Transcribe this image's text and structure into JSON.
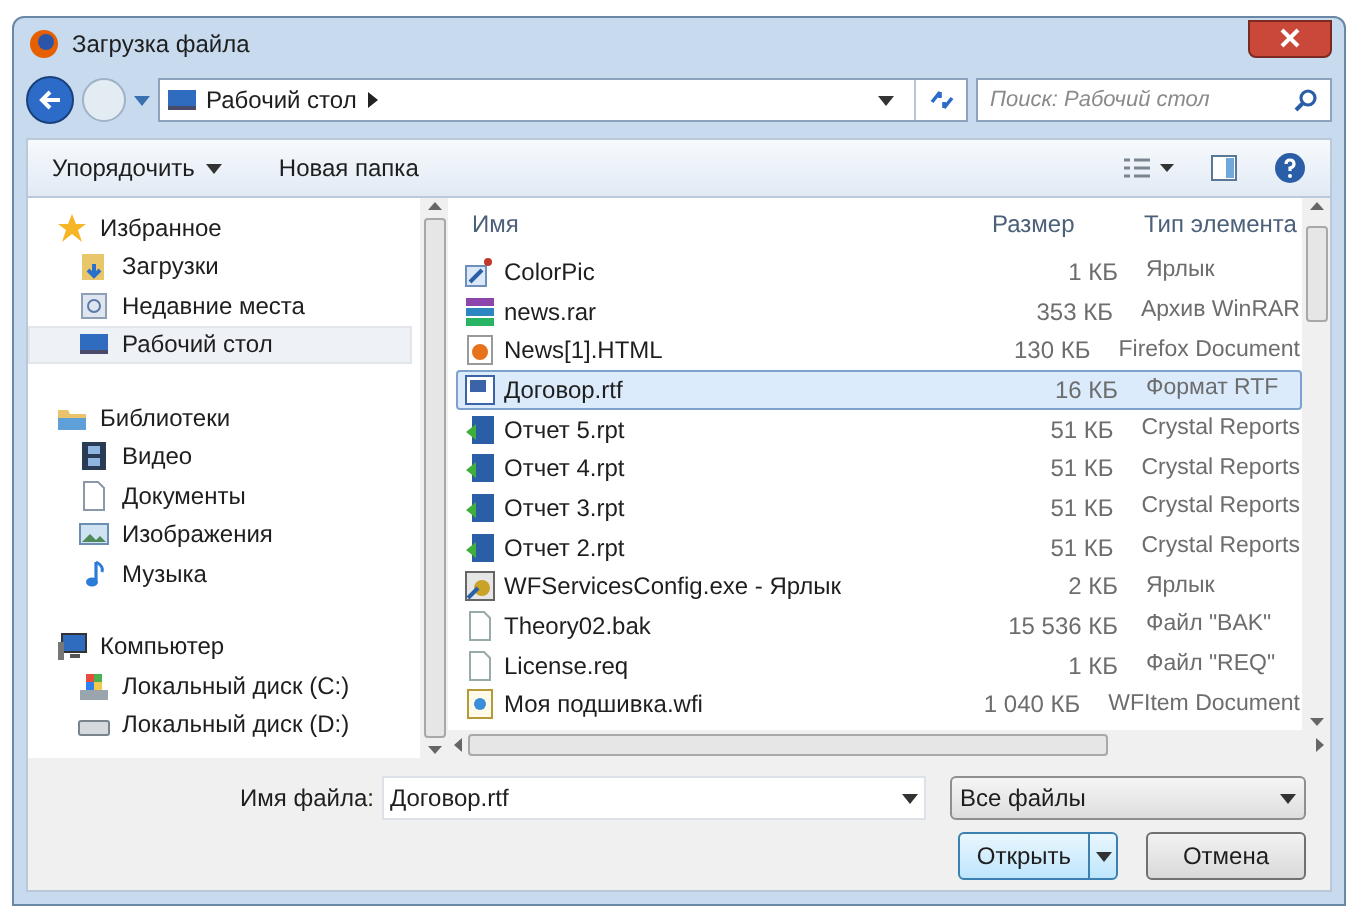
{
  "window": {
    "title": "Загрузка файла"
  },
  "address": {
    "location": "Рабочий стол"
  },
  "search": {
    "placeholder": "Поиск: Рабочий стол"
  },
  "toolbar": {
    "organize": "Упорядочить",
    "new_folder": "Новая папка"
  },
  "sidebar": {
    "groups": [
      {
        "label": "Избранное",
        "kind": "favorites",
        "children": [
          {
            "label": "Загрузки",
            "kind": "downloads",
            "selected": false
          },
          {
            "label": "Недавние места",
            "kind": "recent",
            "selected": false
          },
          {
            "label": "Рабочий стол",
            "kind": "desktop",
            "selected": true
          }
        ]
      },
      {
        "label": "Библиотеки",
        "kind": "libraries",
        "children": [
          {
            "label": "Видео",
            "kind": "video",
            "selected": false
          },
          {
            "label": "Документы",
            "kind": "documents",
            "selected": false
          },
          {
            "label": "Изображения",
            "kind": "images",
            "selected": false
          },
          {
            "label": "Музыка",
            "kind": "music",
            "selected": false
          }
        ]
      },
      {
        "label": "Компьютер",
        "kind": "computer",
        "children": [
          {
            "label": "Локальный диск (C:)",
            "kind": "system_drive",
            "selected": false
          },
          {
            "label": "Локальный диск (D:)",
            "kind": "drive",
            "selected": false
          }
        ]
      }
    ]
  },
  "table": {
    "columns": [
      "Имя",
      "Размер",
      "Тип элемента"
    ],
    "rows": [
      {
        "name": "ColorPic",
        "size": "1 КБ",
        "type": "Ярлык",
        "kind": "shortcut",
        "selected": false
      },
      {
        "name": "news.rar",
        "size": "353 КБ",
        "type": "Архив WinRAR",
        "kind": "archive",
        "selected": false
      },
      {
        "name": "News[1].HTML",
        "size": "130 КБ",
        "type": "Firefox Document",
        "kind": "html",
        "selected": false
      },
      {
        "name": "Договор.rtf",
        "size": "16 КБ",
        "type": "Формат RTF",
        "kind": "rtf",
        "selected": true
      },
      {
        "name": "Отчет 5.rpt",
        "size": "51 КБ",
        "type": "Crystal Reports",
        "kind": "report",
        "selected": false
      },
      {
        "name": "Отчет 4.rpt",
        "size": "51 КБ",
        "type": "Crystal Reports",
        "kind": "report",
        "selected": false
      },
      {
        "name": "Отчет 3.rpt",
        "size": "51 КБ",
        "type": "Crystal Reports",
        "kind": "report",
        "selected": false
      },
      {
        "name": "Отчет 2.rpt",
        "size": "51 КБ",
        "type": "Crystal Reports",
        "kind": "report",
        "selected": false
      },
      {
        "name": "WFServicesConfig.exe - Ярлык",
        "size": "2 КБ",
        "type": "Ярлык",
        "kind": "exe_shortcut",
        "selected": false
      },
      {
        "name": "Theory02.bak",
        "size": "15 536 КБ",
        "type": "Файл \"BAK\"",
        "kind": "generic",
        "selected": false
      },
      {
        "name": "License.req",
        "size": "1 КБ",
        "type": "Файл \"REQ\"",
        "kind": "generic",
        "selected": false
      },
      {
        "name": "Моя подшивка.wfi",
        "size": "1 040 КБ",
        "type": "WFItem Document",
        "kind": "wfi",
        "selected": false
      }
    ]
  },
  "bottom": {
    "filename_label": "Имя файла:",
    "filename": "Договор.rtf",
    "filter": "Все файлы",
    "open": "Открыть",
    "cancel": "Отмена"
  }
}
